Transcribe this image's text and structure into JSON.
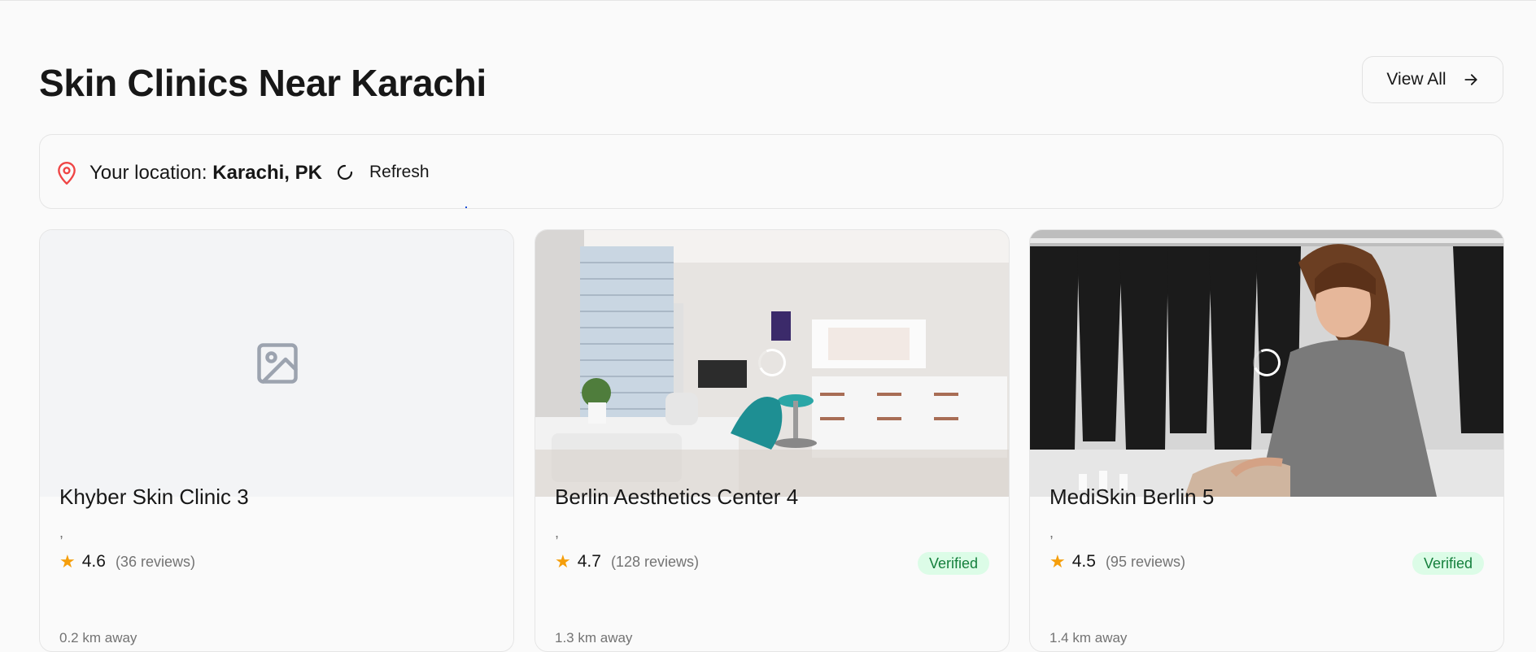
{
  "header": {
    "title": "Skin Clinics Near Karachi",
    "view_all_label": "View All"
  },
  "location": {
    "prefix": "Your location:",
    "value": "Karachi, PK",
    "refresh_label": "Refresh"
  },
  "clinics": [
    {
      "name": "Khyber Skin Clinic 3",
      "address": ",",
      "rating": "4.6",
      "reviews": "(36 reviews)",
      "verified": "",
      "distance": "0.2 km away",
      "image": "image-placeholder-icon"
    },
    {
      "name": "Berlin Aesthetics Center 4",
      "address": ",",
      "rating": "4.7",
      "reviews": "(128 reviews)",
      "verified": "Verified",
      "distance": "1.3 km away",
      "image": "clinic-treatment-room-photo"
    },
    {
      "name": "MediSkin Berlin 5",
      "address": ",",
      "rating": "4.5",
      "reviews": "(95 reviews)",
      "verified": "Verified",
      "distance": "1.4 km away",
      "image": "clinic-staff-photo"
    }
  ],
  "colors": {
    "accent_pin": "#ef4444",
    "star": "#f59e0b",
    "verified_bg": "#dcfce7",
    "verified_text": "#15803d"
  }
}
